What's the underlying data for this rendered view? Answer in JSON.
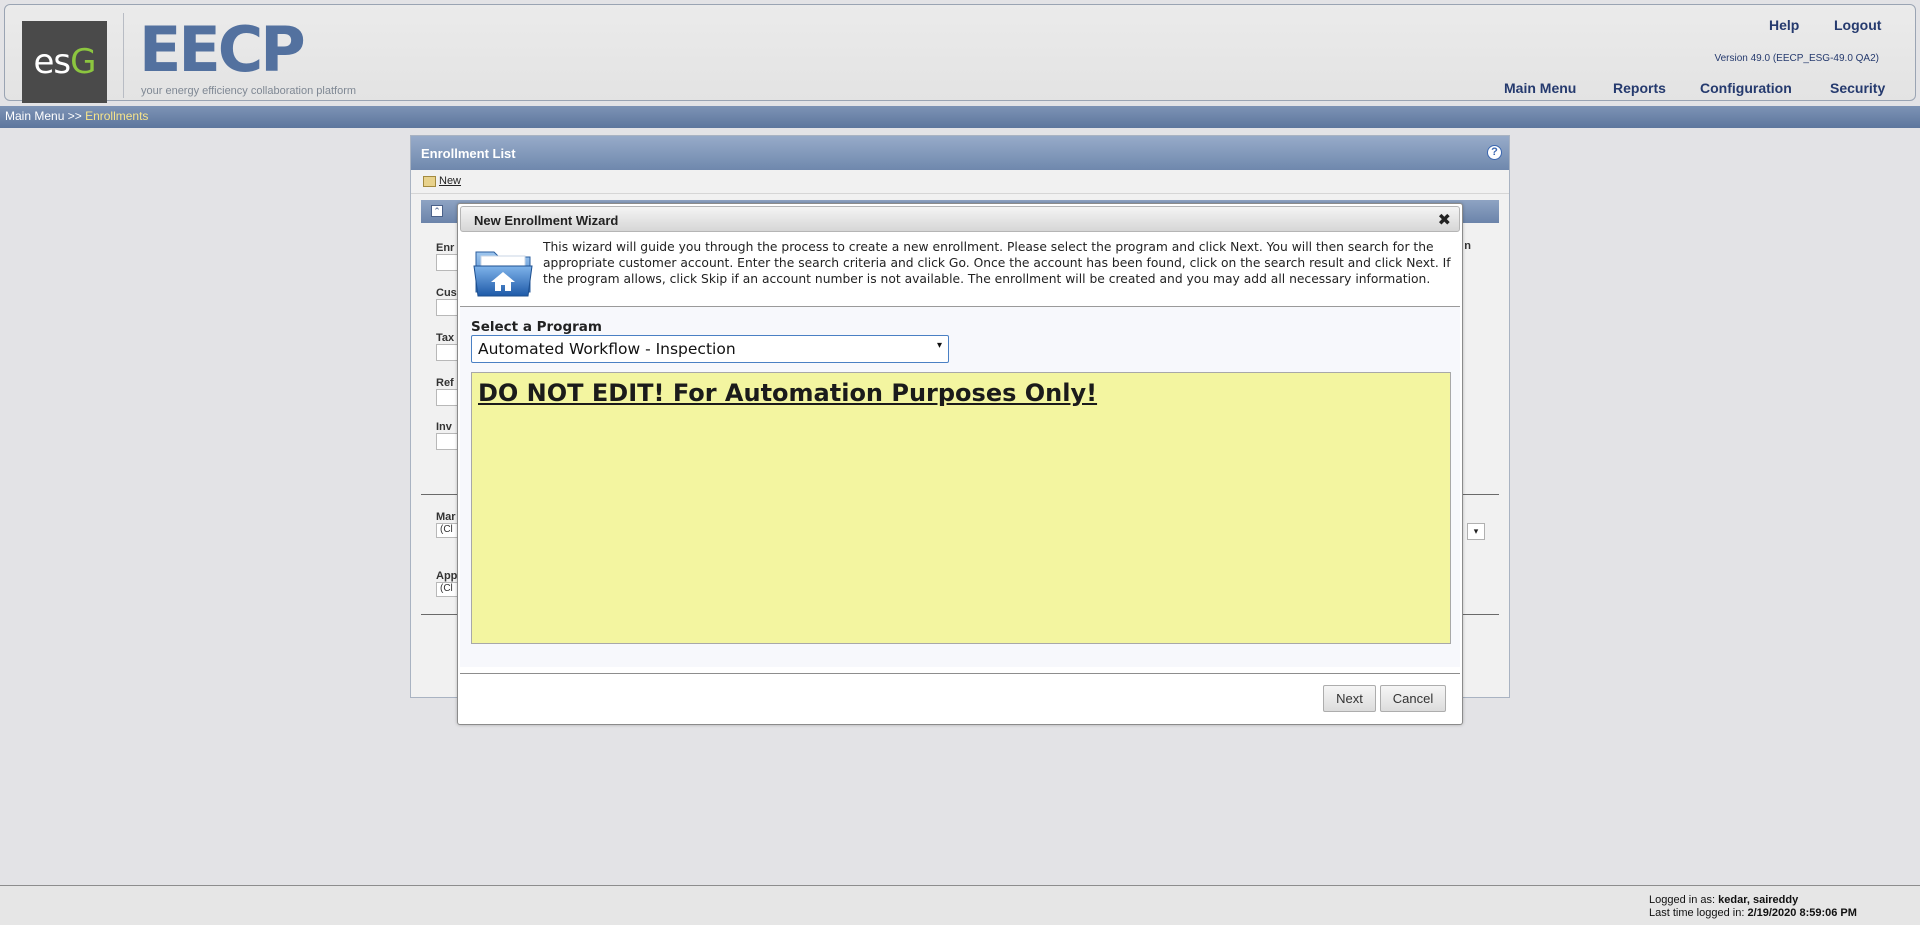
{
  "header": {
    "logo_text_main": "es",
    "logo_text_g": "G",
    "wordmark": "EECP",
    "tagline": "your energy efficiency collaboration platform",
    "help_label": "Help",
    "logout_label": "Logout",
    "version": "Version 49.0 (EECP_ESG-49.0 QA2)",
    "nav": {
      "main_menu": "Main Menu",
      "reports": "Reports",
      "configuration": "Configuration",
      "security": "Security"
    },
    "colors": {
      "nav_text": "#253a6e",
      "logo_bg": "#4a4a4a",
      "logo_accent": "#8cc63f",
      "wordmark": "#53719f"
    }
  },
  "breadcrumb": {
    "root": "Main Menu",
    "separator": ">>",
    "current": "Enrollments"
  },
  "enrollment_list": {
    "title": "Enrollment List",
    "help_icon": "?",
    "new_label": "New",
    "collapse_glyph": "⌃",
    "bg_labels": [
      "Enr",
      "Cus",
      "Tax",
      "Ref",
      "Inv",
      "Mar",
      "App"
    ],
    "bg_select_value": "(Cl",
    "right_label_fragment": "n",
    "right_select_glyph": "▾"
  },
  "wizard": {
    "title": "New Enrollment Wizard",
    "close_glyph": "✖",
    "intro": "This wizard will guide you through the process to create a new enrollment.  Please select the program and click Next.  You will then search for the appropriate customer account.  Enter the search criteria and click Go.  Once the account has been found, click on the search result and click Next.  If the program allows, click Skip if an account number is not available.  The enrollment will be created and you may add all necessary information.",
    "program_label": "Select a Program",
    "program_selected": "Automated Workflow - Inspection",
    "select_caret": "▾",
    "program_description": "DO NOT EDIT! For Automation Purposes Only!",
    "next_label": "Next",
    "cancel_label": "Cancel",
    "colors": {
      "description_bg": "#f3f5a0",
      "select_border": "#4a80c4"
    }
  },
  "footer": {
    "logged_in_prefix": "Logged in as:",
    "logged_in_user": "kedar, saireddy",
    "last_login_prefix": "Last time logged in:",
    "last_login_value": "2/19/2020 8:59:06 PM"
  }
}
